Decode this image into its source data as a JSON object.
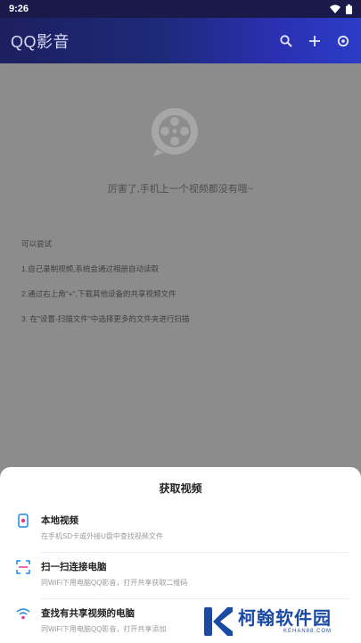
{
  "status": {
    "time": "9:26"
  },
  "app": {
    "title": "QQ影音"
  },
  "empty_state": {
    "message": "厉害了,手机上一个视频都没有哦~"
  },
  "tips": {
    "heading": "可以尝试",
    "items": [
      "1.自己录制视频,系统会通过相册自动读取",
      "2.通过右上角\"+\",下载其他设备的共享视频文件",
      "3. 在\"设置-扫描文件\"中选择更多的文件夹进行扫描"
    ]
  },
  "sheet": {
    "title": "获取视频",
    "options": [
      {
        "title": "本地视频",
        "desc": "在手机SD卡或外接U盘中查找视频文件"
      },
      {
        "title": "扫一扫连接电脑",
        "desc": "同WiFi下用电脑QQ影音，打开共享获取二维码"
      },
      {
        "title": "查找有共享视频的电脑",
        "desc": "同WiFi下用电脑QQ影音，打开共享添加"
      }
    ]
  },
  "watermark": {
    "name": "柯翰软件园",
    "domain": "KEHAN88.COM"
  },
  "colors": {
    "accent": "#1e88e5",
    "appbar": "#1d2a7a"
  }
}
